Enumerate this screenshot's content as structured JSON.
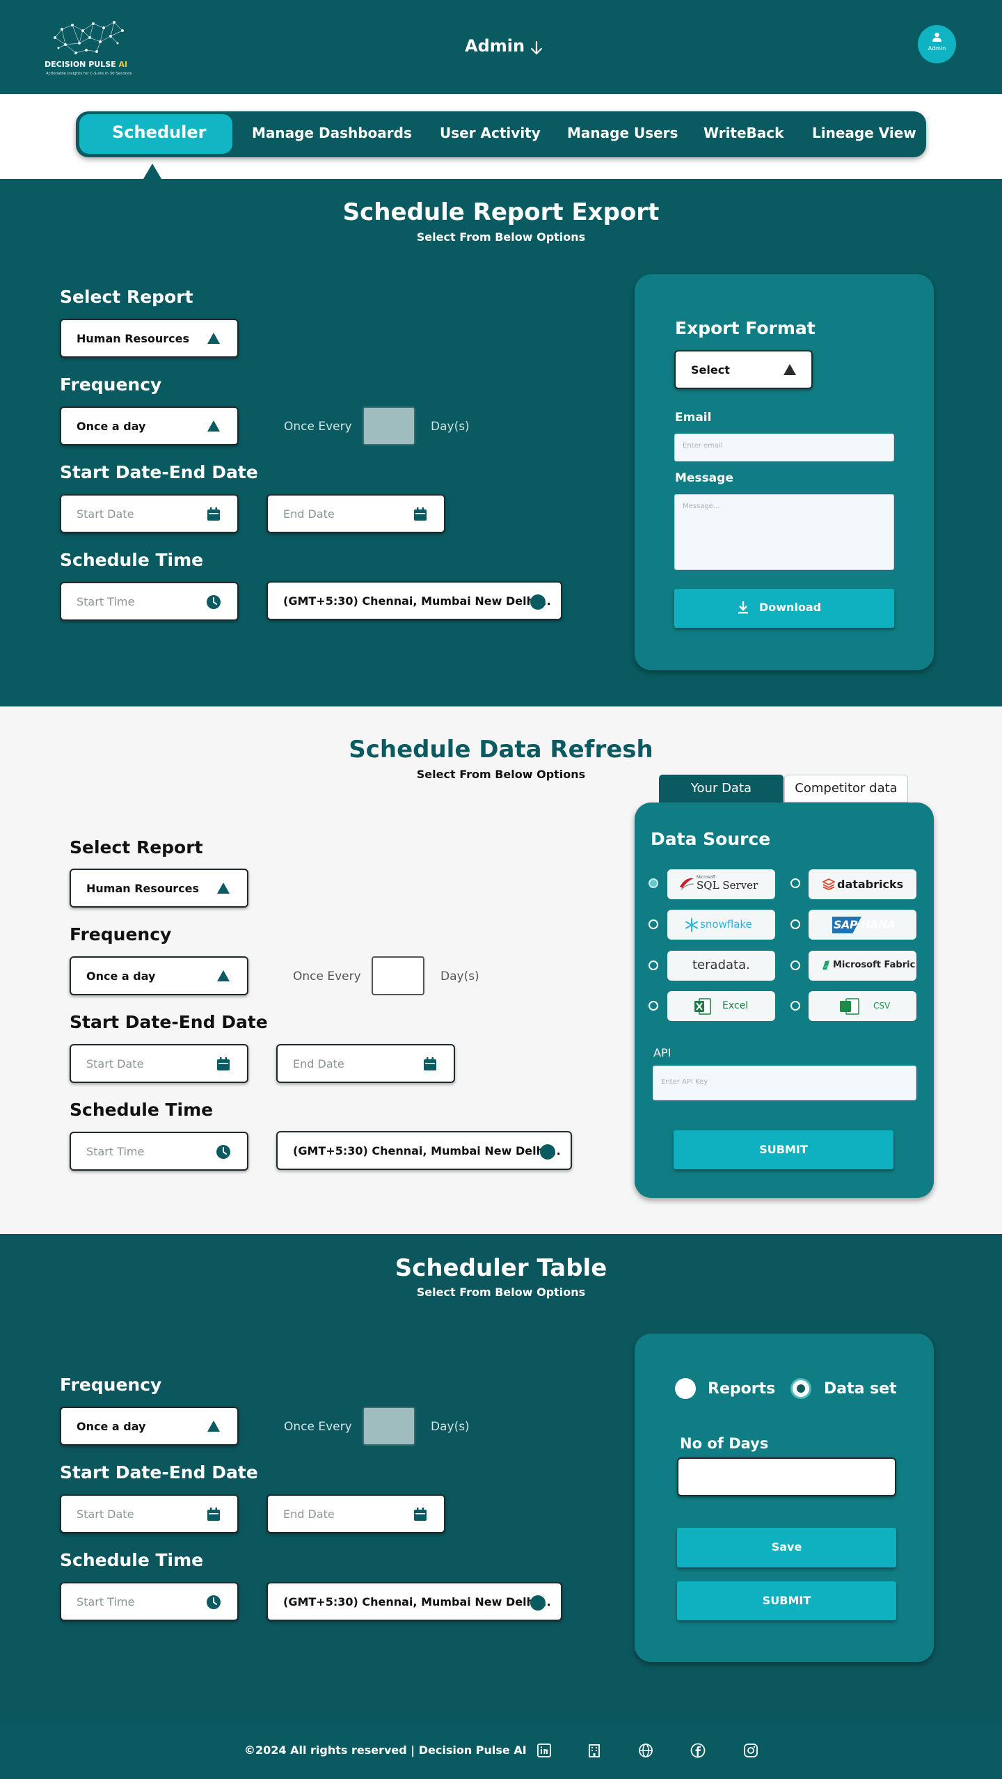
{
  "header": {
    "logo_name": "DECISION PULSE",
    "logo_ai": "AI",
    "logo_tagline": "Actionable insights for C-Suite in 30 Seconds",
    "admin_label": "Admin",
    "avatar_label": "Admin"
  },
  "nav": {
    "items": [
      "Scheduler",
      "Manage Dashboards",
      "User Activity",
      "Manage Users",
      "WriteBack",
      "Lineage View"
    ]
  },
  "export_section": {
    "title": "Schedule Report Export",
    "subtitle": "Select From Below Options",
    "select_report_label": "Select Report",
    "report_value": "Human Resources",
    "frequency_label": "Frequency",
    "frequency_value": "Once a day",
    "once_every": "Once Every",
    "days": "Day(s)",
    "date_label": "Start Date-End Date",
    "start_date": "Start Date",
    "end_date": "End Date",
    "time_label": "Schedule Time",
    "start_time": "Start Time",
    "timezone": "(GMT+5:30) Chennai, Mumbai New Delhi...",
    "card": {
      "title": "Export Format",
      "format_value": "Select",
      "email_label": "Email",
      "email_placeholder": "Enter email",
      "message_label": "Message",
      "message_placeholder": "Message...",
      "download": "Download"
    }
  },
  "refresh_section": {
    "title": "Schedule Data Refresh",
    "subtitle": "Select From Below Options",
    "select_report_label": "Select Report",
    "report_value": "Human Resources",
    "frequency_label": "Frequency",
    "frequency_value": "Once a day",
    "once_every": "Once Every",
    "days": "Day(s)",
    "date_label": "Start Date-End Date",
    "start_date": "Start Date",
    "end_date": "End Date",
    "time_label": "Schedule Time",
    "start_time": "Start Time",
    "timezone": "(GMT+5:30) Chennai, Mumbai New Delhi...",
    "tabs": [
      "Your Data",
      "Competitor data"
    ],
    "card": {
      "title": "Data Source",
      "sources": [
        "SQL Server",
        "databricks",
        "snowflake",
        "SAP HANA",
        "teradata.",
        "Microsoft Fabric",
        "Excel",
        "CSV"
      ],
      "sql_small": "Microsoft",
      "api_label": "API",
      "api_placeholder": "Enter API Key",
      "submit": "SUBMIT"
    }
  },
  "table_section": {
    "title": "Scheduler Table",
    "subtitle": "Select From Below Options",
    "frequency_label": "Frequency",
    "frequency_value": "Once a day",
    "once_every": "Once Every",
    "days": "Day(s)",
    "date_label": "Start Date-End Date",
    "start_date": "Start Date",
    "end_date": "End Date",
    "time_label": "Schedule Time",
    "start_time": "Start Time",
    "timezone": "(GMT+5:30) Chennai, Mumbai New Delhi...",
    "card": {
      "radio_reports": "Reports",
      "radio_dataset": "Data set",
      "days_label": "No of Days",
      "save": "Save",
      "submit": "SUBMIT"
    }
  },
  "footer": {
    "text": "©2024 All rights reserved | Decision Pulse AI",
    "icons": [
      "linkedin-icon",
      "building-icon",
      "globe-icon",
      "facebook-icon",
      "instagram-icon"
    ]
  }
}
